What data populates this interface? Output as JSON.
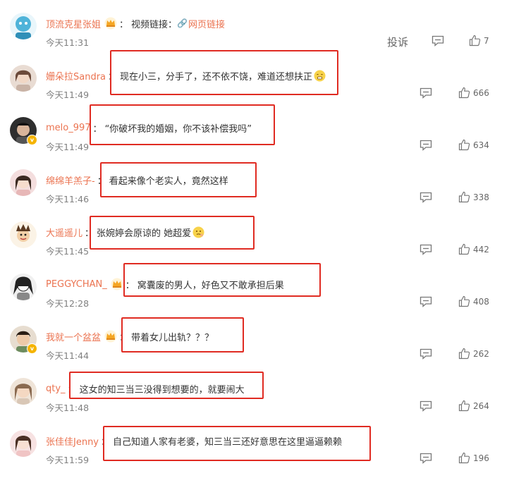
{
  "comments": [
    {
      "username": "顶流克星张姐",
      "crown": true,
      "verified": false,
      "content": "视频链接：",
      "link_text": "网页链接",
      "time": "今天11:31",
      "likes": "7",
      "report": "投诉",
      "avatar_color": "#4fb3d9"
    },
    {
      "username": "姗朵拉Sandra",
      "crown": false,
      "verified": false,
      "content": "现在小三，分手了，还不依不饶，难道还想扶正",
      "time": "今天11:49",
      "likes": "666",
      "avatar_color": "#d8c4b8"
    },
    {
      "username": "melo_997",
      "crown": false,
      "verified": true,
      "content": "“你破坏我的婚姻，你不该补偿我吗”",
      "time": "今天11:49",
      "likes": "634",
      "avatar_color": "#3a3a3a"
    },
    {
      "username": "绵绵羊羔子-",
      "crown": false,
      "verified": false,
      "content": "看起来像个老实人，竟然这样",
      "time": "今天11:46",
      "likes": "338",
      "avatar_color": "#f0cfcf"
    },
    {
      "username": "大遥遥儿",
      "crown": false,
      "verified": false,
      "content": "张婉婷会原谅的 她超爱",
      "time": "今天11:45",
      "likes": "442",
      "avatar_color": "#f3e2c4"
    },
    {
      "username": "PEGGYCHAN_",
      "crown": true,
      "verified": false,
      "content": "窝囊废的男人，好色又不敢承担后果",
      "time": "今天12:28",
      "likes": "408",
      "avatar_color": "#dcdcdc"
    },
    {
      "username": "我就一个盆盆",
      "crown": true,
      "verified": true,
      "content": "带着女儿出轨？？？",
      "time": "今天11:44",
      "likes": "262",
      "avatar_color": "#cbbca6"
    },
    {
      "username": "qty_",
      "crown": false,
      "verified": false,
      "content": "这女的知三当三没得到想要的，就要闹大",
      "time": "今天11:48",
      "likes": "264",
      "avatar_color": "#e6d6c6"
    },
    {
      "username": "张佳佳Jenny",
      "crown": false,
      "verified": false,
      "content": "自己知道人家有老婆，知三当三还好意思在这里逼逼赖赖",
      "time": "今天11:59",
      "likes": "196",
      "avatar_color": "#f2d8d8"
    }
  ],
  "colors": {
    "username": "#eb7350",
    "highlight_box": "#e02b22",
    "meta_text": "#808080"
  },
  "icons": {
    "reply": "comment-icon",
    "like": "thumbs-up-icon",
    "link": "link-icon",
    "crown": "crown-badge-icon",
    "emoji": "emoji-icon"
  }
}
